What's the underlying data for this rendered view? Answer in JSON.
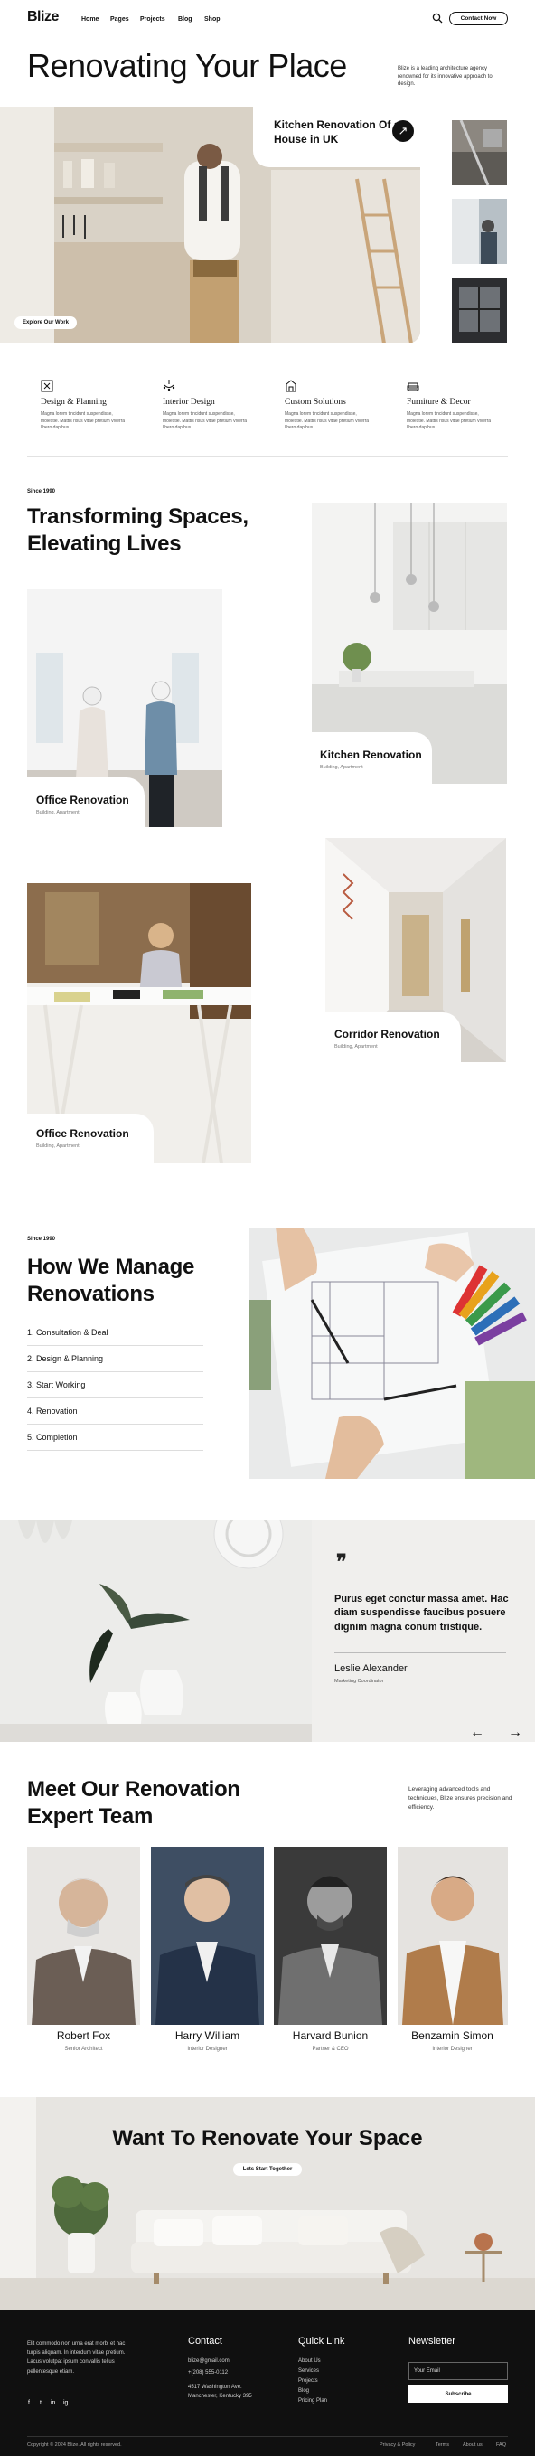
{
  "nav": {
    "logo": "Blize",
    "links": [
      "Home",
      "Pages",
      "Projects",
      "Blog",
      "Shop"
    ],
    "contact_label": "Contact Now"
  },
  "hero": {
    "title": "Renovating Your Place",
    "description": "Blize is a leading architecture agency renowned for its innovative approach to design.",
    "explore_label": "Explore Our Work",
    "caption": "Kitchen Renovation Of a House in UK"
  },
  "services": [
    {
      "title": "Design & Planning",
      "text": "Magna lorem tincidunt suspendisse, molestie. Mattis risus vitae pretium viverra libero dapibus.",
      "icon": "blueprint-icon"
    },
    {
      "title": "Interior Design",
      "text": "Magna lorem tincidunt suspendisse, molestie. Mattis risus vitae pretium viverra libero dapibus.",
      "icon": "chandelier-icon"
    },
    {
      "title": "Custom Solutions",
      "text": "Magna lorem tincidunt suspendisse, molestie. Mattis risus vitae pretium viverra libero dapibus.",
      "icon": "building-icon"
    },
    {
      "title": "Furniture & Decor",
      "text": "Magna lorem tincidunt suspendisse, molestie. Mattis risus vitae pretium viverra libero dapibus.",
      "icon": "sofa-icon"
    }
  ],
  "projects": {
    "since": "Since 1990",
    "title": "Transforming Spaces, Elevating Lives",
    "items": [
      {
        "title": "Kitchen Renovation",
        "sub": "Building, Apartment"
      },
      {
        "title": "Office Renovation",
        "sub": "Building, Apartment"
      },
      {
        "title": "Corridor Renovation",
        "sub": "Building, Apartment"
      },
      {
        "title": "Office Renovation",
        "sub": "Building, Apartment"
      }
    ]
  },
  "process": {
    "since": "Since 1990",
    "title": "How We Manage Renovations",
    "steps": [
      "1. Consultation & Deal",
      "2. Design & Planning",
      "3. Start Working",
      "4. Renovation",
      "5. Completion"
    ]
  },
  "testimonial": {
    "quote": "Purus eget conctur massa amet. Hac diam suspendisse faucibus posuere dignim magna conum tristique.",
    "name": "Leslie Alexander",
    "role": "Marketing Coordinator",
    "prev": "←",
    "next": "→"
  },
  "team": {
    "title": "Meet Our Renovation Expert Team",
    "description": "Leveraging advanced tools and techniques, Blize ensures precision and efficiency.",
    "members": [
      {
        "name": "Robert Fox",
        "role": "Senior Architect"
      },
      {
        "name": "Harry William",
        "role": "Interior Designer"
      },
      {
        "name": "Harvard Bunion",
        "role": "Partner & CEO"
      },
      {
        "name": "Benzamin Simon",
        "role": "Interior Designer"
      }
    ]
  },
  "cta": {
    "title": "Want To Renovate Your Space",
    "button": "Lets Start Together"
  },
  "footer": {
    "about": "Elit commodo non urna erat morbi et hac turpis aliquam. In interdum vitae pretium. Lacus volutpat ipsum convallis tellus pellentesque etiam.",
    "contact_title": "Contact",
    "email": "blize@gmail.com",
    "phone": "+(208) 555-0112",
    "address": "4517 Washington Ave. Manchester, Kentucky 395",
    "quick_title": "Quick Link",
    "quick_links": [
      "About Us",
      "Services",
      "Projects",
      "Blog",
      "Pricing Plan"
    ],
    "news_title": "Newsletter",
    "email_placeholder": "Your Email",
    "subscribe": "Subscribe",
    "copyright": "Copyright © 2024 Blize. All rights reserved.",
    "bottom_links": [
      "Privacy & Policy",
      "Terms",
      "About us",
      "FAQ"
    ],
    "social": [
      "f",
      "t",
      "in",
      "ig"
    ]
  }
}
